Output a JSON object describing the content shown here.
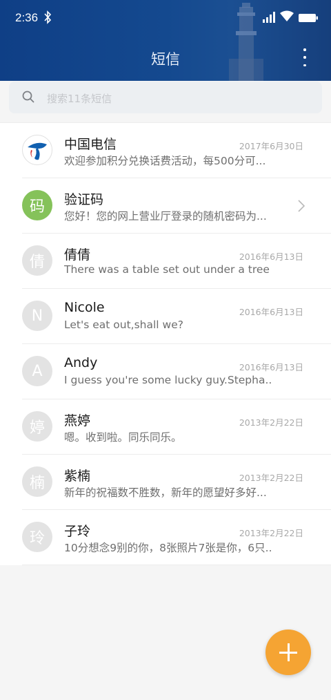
{
  "status_bar": {
    "time": "2:36"
  },
  "header": {
    "title": "短信"
  },
  "search": {
    "placeholder": "搜索11条短信"
  },
  "conversations": [
    {
      "name": "中国电信",
      "preview": "欢迎参加积分兑换话费活动，每500分可...",
      "date": "2017年6月30日",
      "avatar": "",
      "avatar_type": "logo"
    },
    {
      "name": "验证码",
      "preview": "您好！您的网上营业厅登录的随机密码为...",
      "date": "",
      "avatar": "码",
      "avatar_type": "green"
    },
    {
      "name": "倩倩",
      "preview": "There was a table set out under a tree i...",
      "date": "2016年6月13日",
      "avatar": "倩",
      "avatar_type": "gray"
    },
    {
      "name": "Nicole",
      "preview": "Let's eat out,shall we?",
      "date": "2016年6月13日",
      "avatar": "N",
      "avatar_type": "gray"
    },
    {
      "name": "Andy",
      "preview": "I guess you're some lucky guy.Stepha...",
      "date": "2016年6月13日",
      "avatar": "A",
      "avatar_type": "gray"
    },
    {
      "name": "燕婷",
      "preview": "嗯。收到啦。同乐同乐。",
      "date": "2013年2月22日",
      "avatar": "婷",
      "avatar_type": "gray"
    },
    {
      "name": "紫楠",
      "preview": "新年的祝福数不胜数，新年的愿望好多好...",
      "date": "2013年2月22日",
      "avatar": "楠",
      "avatar_type": "gray"
    },
    {
      "name": "子玲",
      "preview": "10分想念9别的你，8张照片7张是你，6只...",
      "date": "2013年2月22日",
      "avatar": "玲",
      "avatar_type": "gray"
    }
  ],
  "colors": {
    "header": "#14498f",
    "fab": "#f5a433",
    "verify_avatar": "#85c25a"
  },
  "icons": [
    "bluetooth-icon",
    "signal-icon",
    "wifi-icon",
    "battery-icon",
    "more-vert-icon",
    "search-icon",
    "chevron-right-icon",
    "plus-icon"
  ]
}
